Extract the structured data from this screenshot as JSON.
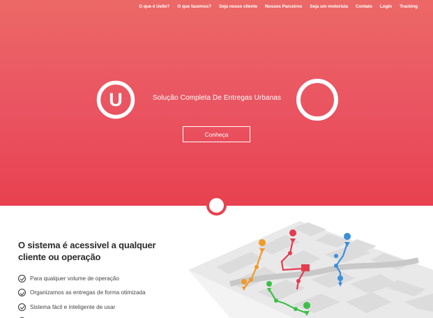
{
  "nav": {
    "items": [
      "O que é Uello?",
      "O que fazemos?",
      "Seja nosso cliente",
      "Nossos Parceiros",
      "Seja um motorista",
      "Contato",
      "Login",
      "Tracking"
    ]
  },
  "hero": {
    "tagline": "Solução Completa De Entregas Urbanas",
    "cta_label": "Conheça",
    "logo_letter": "U"
  },
  "content": {
    "title": "O sistema é acessivel a qualquer cliente ou operação",
    "features": [
      "Para qualquer volume de operação",
      "Organizamos as entregas de forma otimizada",
      "Sistema fácil e inteligente de usar"
    ]
  },
  "colors": {
    "brand": "#e8414f",
    "route_red": "#e23d4f",
    "route_blue": "#3c8fdc",
    "route_orange": "#f09a2b",
    "route_green": "#3cc04a"
  }
}
